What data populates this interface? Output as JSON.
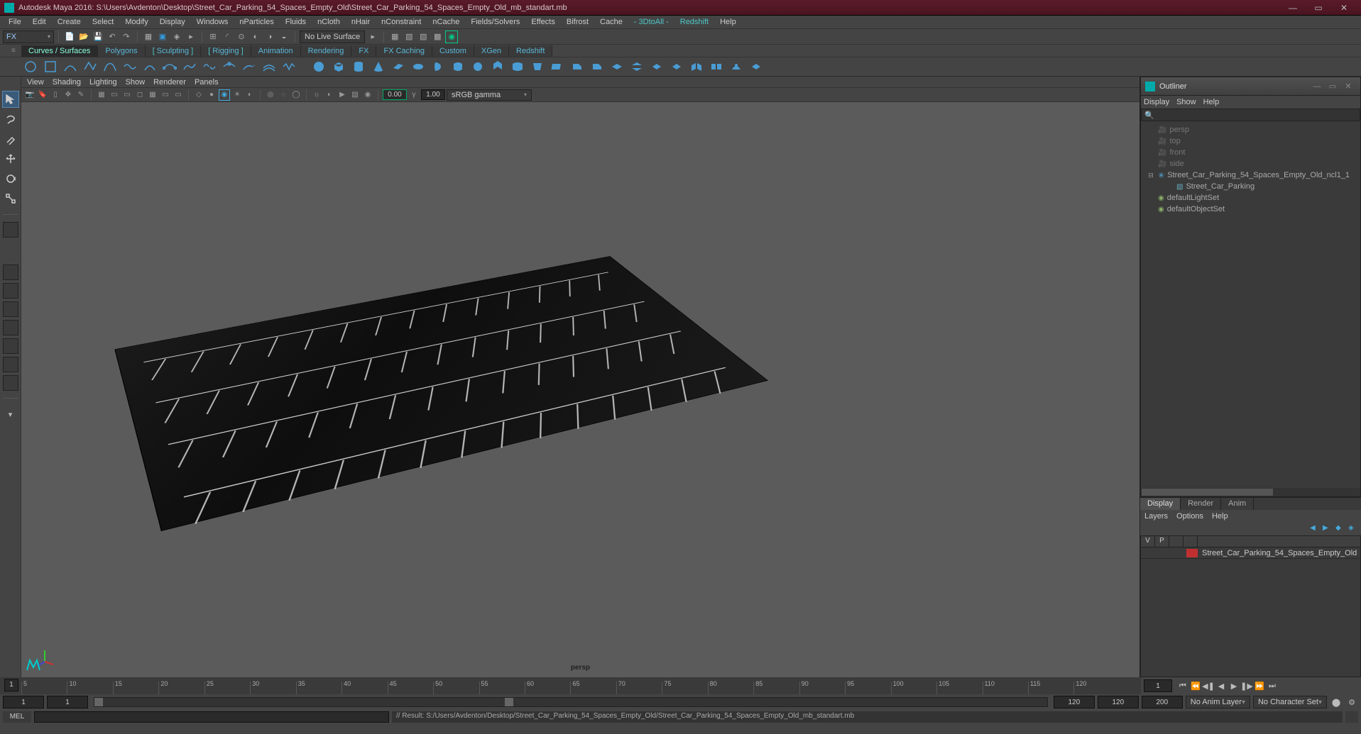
{
  "title_bar": {
    "title": "Autodesk Maya 2016: S:\\Users\\Avdenton\\Desktop\\Street_Car_Parking_54_Spaces_Empty_Old\\Street_Car_Parking_54_Spaces_Empty_Old_mb_standart.mb",
    "minimize": "—",
    "maximize": "▭",
    "close": "✕"
  },
  "main_menu": [
    "File",
    "Edit",
    "Create",
    "Select",
    "Modify",
    "Display",
    "Windows",
    "nParticles",
    "Fluids",
    "nCloth",
    "nHair",
    "nConstraint",
    "nCache",
    "Fields/Solvers",
    "Effects",
    "Bifrost",
    "Cache",
    "- 3DtoAll -",
    "Redshift",
    "Help"
  ],
  "status": {
    "workspace": "FX",
    "live_surface": "No Live Surface"
  },
  "shelf_tabs": [
    "Curves / Surfaces",
    "Polygons",
    "Sculpting",
    "Rigging",
    "Animation",
    "Rendering",
    "FX",
    "FX Caching",
    "Custom",
    "XGen",
    "Redshift"
  ],
  "shelf_active_tab": 0,
  "viewport_menu": [
    "View",
    "Shading",
    "Lighting",
    "Show",
    "Renderer",
    "Panels"
  ],
  "viewport": {
    "exposure_value": "0.00",
    "gamma_value": "1.00",
    "color_space": "sRGB gamma",
    "camera_label": "persp"
  },
  "outliner": {
    "title": "Outliner",
    "menus": [
      "Display",
      "Show",
      "Help"
    ],
    "items": [
      {
        "type": "cam",
        "label": "persp",
        "dim": true,
        "indent": 0
      },
      {
        "type": "cam",
        "label": "top",
        "dim": true,
        "indent": 0
      },
      {
        "type": "cam",
        "label": "front",
        "dim": true,
        "indent": 0
      },
      {
        "type": "cam",
        "label": "side",
        "dim": true,
        "indent": 0
      },
      {
        "type": "xform",
        "label": "Street_Car_Parking_54_Spaces_Empty_Old_ncl1_1",
        "dim": false,
        "indent": 0,
        "expander": "⊟"
      },
      {
        "type": "mesh",
        "label": "Street_Car_Parking",
        "dim": false,
        "indent": 1,
        "expander": ""
      },
      {
        "type": "set",
        "label": "defaultLightSet",
        "dim": false,
        "indent": 0
      },
      {
        "type": "set",
        "label": "defaultObjectSet",
        "dim": false,
        "indent": 0
      }
    ]
  },
  "right_tabs": {
    "tabs": [
      "Display",
      "Render",
      "Anim"
    ],
    "active": 0,
    "menu": [
      "Layers",
      "Options",
      "Help"
    ]
  },
  "layers": [
    {
      "v": "V",
      "p": "P",
      "color": "#c03030",
      "name": "Street_Car_Parking_54_Spaces_Empty_Old"
    }
  ],
  "timeline": {
    "current": "1",
    "ticks": [
      "5",
      "10",
      "15",
      "20",
      "25",
      "30",
      "35",
      "40",
      "45",
      "50",
      "55",
      "60",
      "65",
      "70",
      "75",
      "80",
      "85",
      "90",
      "95",
      "100",
      "105",
      "110",
      "115",
      "120"
    ],
    "play_current": "1"
  },
  "range": {
    "start_outer": "1",
    "start_inner": "1",
    "end_inner": "120",
    "end_outer": "120",
    "end_outer2": "200",
    "anim_layer": "No Anim Layer",
    "char_set": "No Character Set"
  },
  "command": {
    "lang": "MEL",
    "result": "// Result: S:/Users/Avdenton/Desktop/Street_Car_Parking_54_Spaces_Empty_Old/Street_Car_Parking_54_Spaces_Empty_Old_mb_standart.mb"
  }
}
